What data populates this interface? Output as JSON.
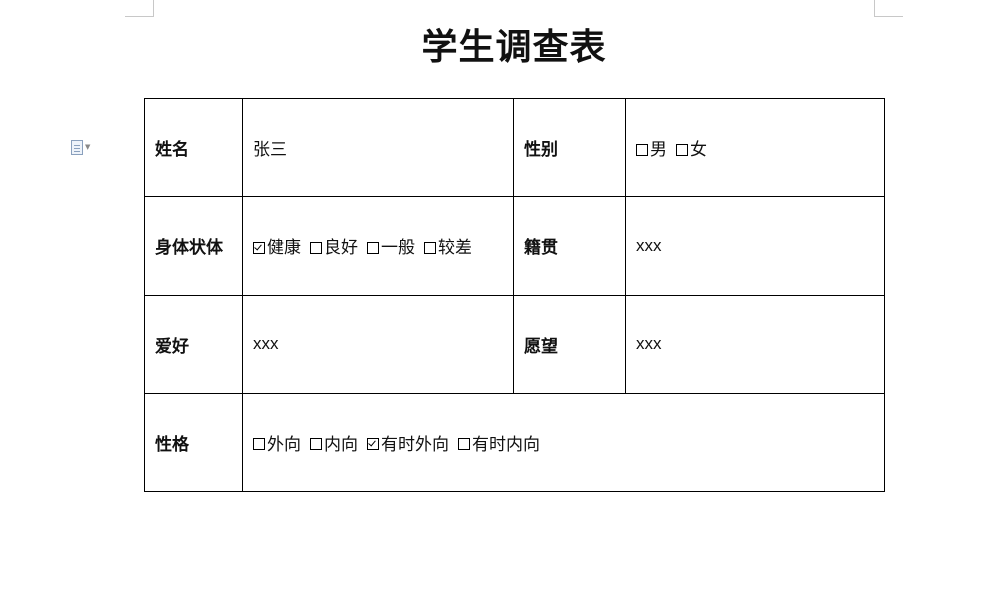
{
  "title": "学生调查表",
  "rows": {
    "name": {
      "label": "姓名",
      "value": "张三"
    },
    "gender": {
      "label": "性别",
      "options": [
        {
          "text": "男",
          "checked": false
        },
        {
          "text": "女",
          "checked": false
        }
      ]
    },
    "health": {
      "label": "身体状体",
      "options": [
        {
          "text": "健康",
          "checked": true
        },
        {
          "text": "良好",
          "checked": false
        },
        {
          "text": "一般",
          "checked": false
        },
        {
          "text": "较差",
          "checked": false
        }
      ]
    },
    "native": {
      "label": "籍贯",
      "value": "xxx"
    },
    "hobby": {
      "label": "爱好",
      "value": "xxx"
    },
    "wish": {
      "label": "愿望",
      "value": "xxx"
    },
    "character": {
      "label": "性格",
      "options": [
        {
          "text": "外向",
          "checked": false
        },
        {
          "text": "内向",
          "checked": false
        },
        {
          "text": "有时外向",
          "checked": true
        },
        {
          "text": "有时内向",
          "checked": false
        }
      ]
    }
  }
}
